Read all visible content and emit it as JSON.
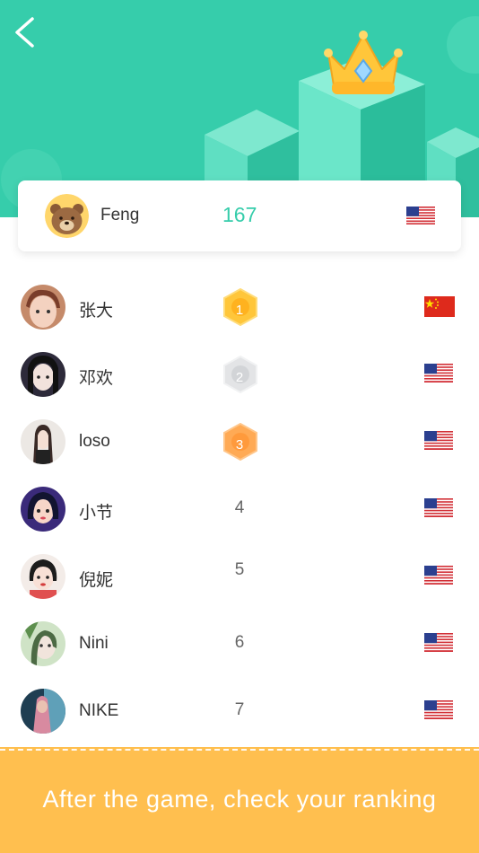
{
  "header": {
    "back_icon": "chevron-left-icon",
    "decoration": "crown-on-podium"
  },
  "me": {
    "name": "Feng",
    "score": "167",
    "country": "US",
    "avatar": "brown-bear-avatar"
  },
  "ranking": [
    {
      "rank": "1",
      "name": "张大",
      "country": "CN",
      "medal": "gold"
    },
    {
      "rank": "2",
      "name": "邓欢",
      "country": "US",
      "medal": "silver"
    },
    {
      "rank": "3",
      "name": "loso",
      "country": "US",
      "medal": "bronze"
    },
    {
      "rank": "4",
      "name": "小节",
      "country": "US",
      "medal": ""
    },
    {
      "rank": "5",
      "name": "倪妮",
      "country": "US",
      "medal": ""
    },
    {
      "rank": "6",
      "name": "Nini",
      "country": "US",
      "medal": ""
    },
    {
      "rank": "7",
      "name": "NIKE",
      "country": "US",
      "medal": ""
    }
  ],
  "footer": {
    "cta_text": "After the game, check your ranking"
  },
  "colors": {
    "accent": "#36cdab",
    "cta": "#ffbf4f",
    "gold": "#ffc63a",
    "silver": "#e3e4e6",
    "bronze": "#ffaa55"
  }
}
